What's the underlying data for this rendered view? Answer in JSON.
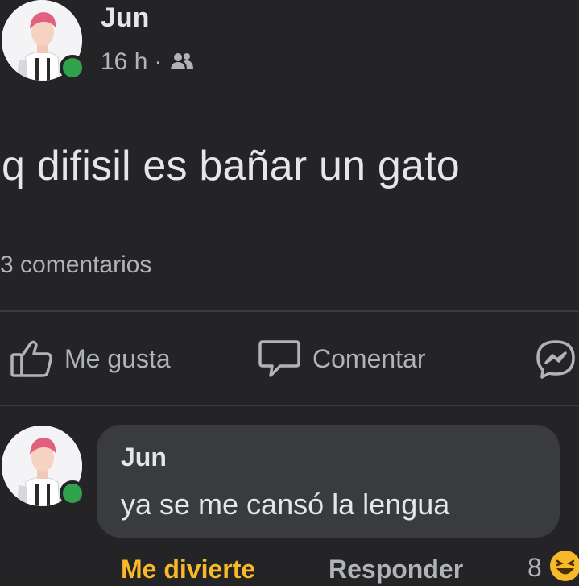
{
  "post": {
    "author": "Jun",
    "time": "16 h",
    "separator": "·",
    "privacy_icon": "friends-icon",
    "text": "q difisil es bañar un gato",
    "comments_count": "3 comentarios"
  },
  "actions": {
    "like_label": "Me gusta",
    "comment_label": "Comentar",
    "like_icon": "thumbs-up-icon",
    "comment_icon": "speech-bubble-icon",
    "share_icon": "messenger-icon"
  },
  "comment": {
    "author": "Jun",
    "text": "ya se me cansó la lengua",
    "reaction_label": "Me divierte",
    "reply_label": "Responder",
    "reaction_count": "8",
    "reaction_icon": "haha-emoji-icon"
  },
  "colors": {
    "background": "#242427",
    "bubble": "#3a3b3c",
    "reaction_accent": "#f7b928",
    "online": "#31a24c"
  }
}
